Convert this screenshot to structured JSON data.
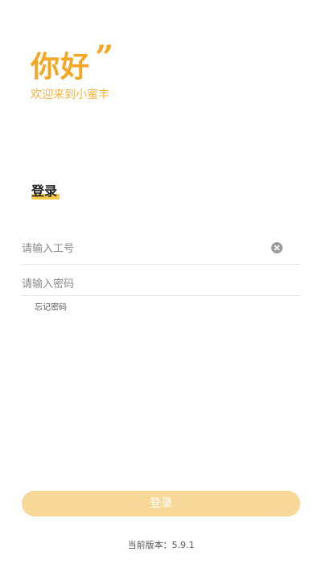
{
  "greeting": {
    "title": "你好",
    "quote_mark": "”",
    "subtitle": "欢迎来到小蜜丰"
  },
  "login_section": {
    "title": "登录"
  },
  "form": {
    "account_placeholder": "请输入工号",
    "account_value": "",
    "password_placeholder": "请输入密码",
    "password_value": "",
    "forgot_password_label": "忘记密码"
  },
  "actions": {
    "login_label": "登录"
  },
  "footer": {
    "version_label": "当前版本：",
    "version_number": "5.9.1"
  },
  "colors": {
    "accent": "#F5A623",
    "accent_underline": "#F7C948",
    "button_bg": "#F8D898",
    "clear_icon": "#9B9B9B"
  },
  "icons": {
    "clear_icon": "clear-icon"
  }
}
